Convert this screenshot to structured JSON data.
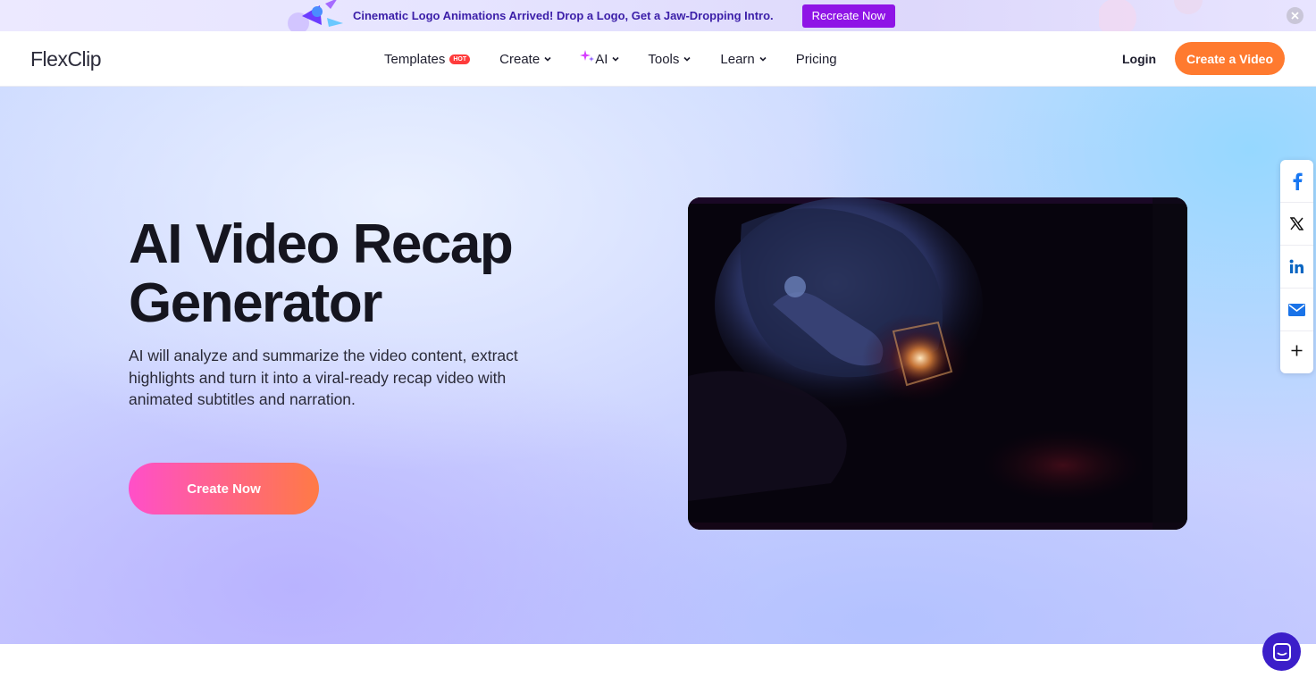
{
  "banner": {
    "text": "Cinematic Logo Animations Arrived! Drop a Logo, Get a Jaw-Dropping Intro.",
    "button_label": "Recreate Now"
  },
  "header": {
    "logo_text": "FlexClip",
    "nav": [
      {
        "label": "Templates",
        "badge": "HOT"
      },
      {
        "label": "Create",
        "has_dropdown": true
      },
      {
        "label": "AI",
        "has_dropdown": true,
        "icon": "sparkle-icon"
      },
      {
        "label": "Tools",
        "has_dropdown": true
      },
      {
        "label": "Learn",
        "has_dropdown": true
      },
      {
        "label": "Pricing"
      }
    ],
    "login_label": "Login",
    "cta_label": "Create a Video"
  },
  "hero": {
    "title_line1": "AI Video Recap",
    "title_line2": "Generator",
    "description": "AI will analyze and summarize the video content, extract highlights and turn it into a viral-ready recap video with animated subtitles and narration.",
    "cta_label": "Create Now"
  },
  "share": {
    "icons": [
      "facebook-icon",
      "x-icon",
      "linkedin-icon",
      "email-icon",
      "plus-icon"
    ]
  },
  "colors": {
    "accent_orange": "#ff7a2f",
    "banner_button": "#8f14e6",
    "hot_badge": "#ff3b3b",
    "chat_bubble": "#3b1ec9"
  }
}
